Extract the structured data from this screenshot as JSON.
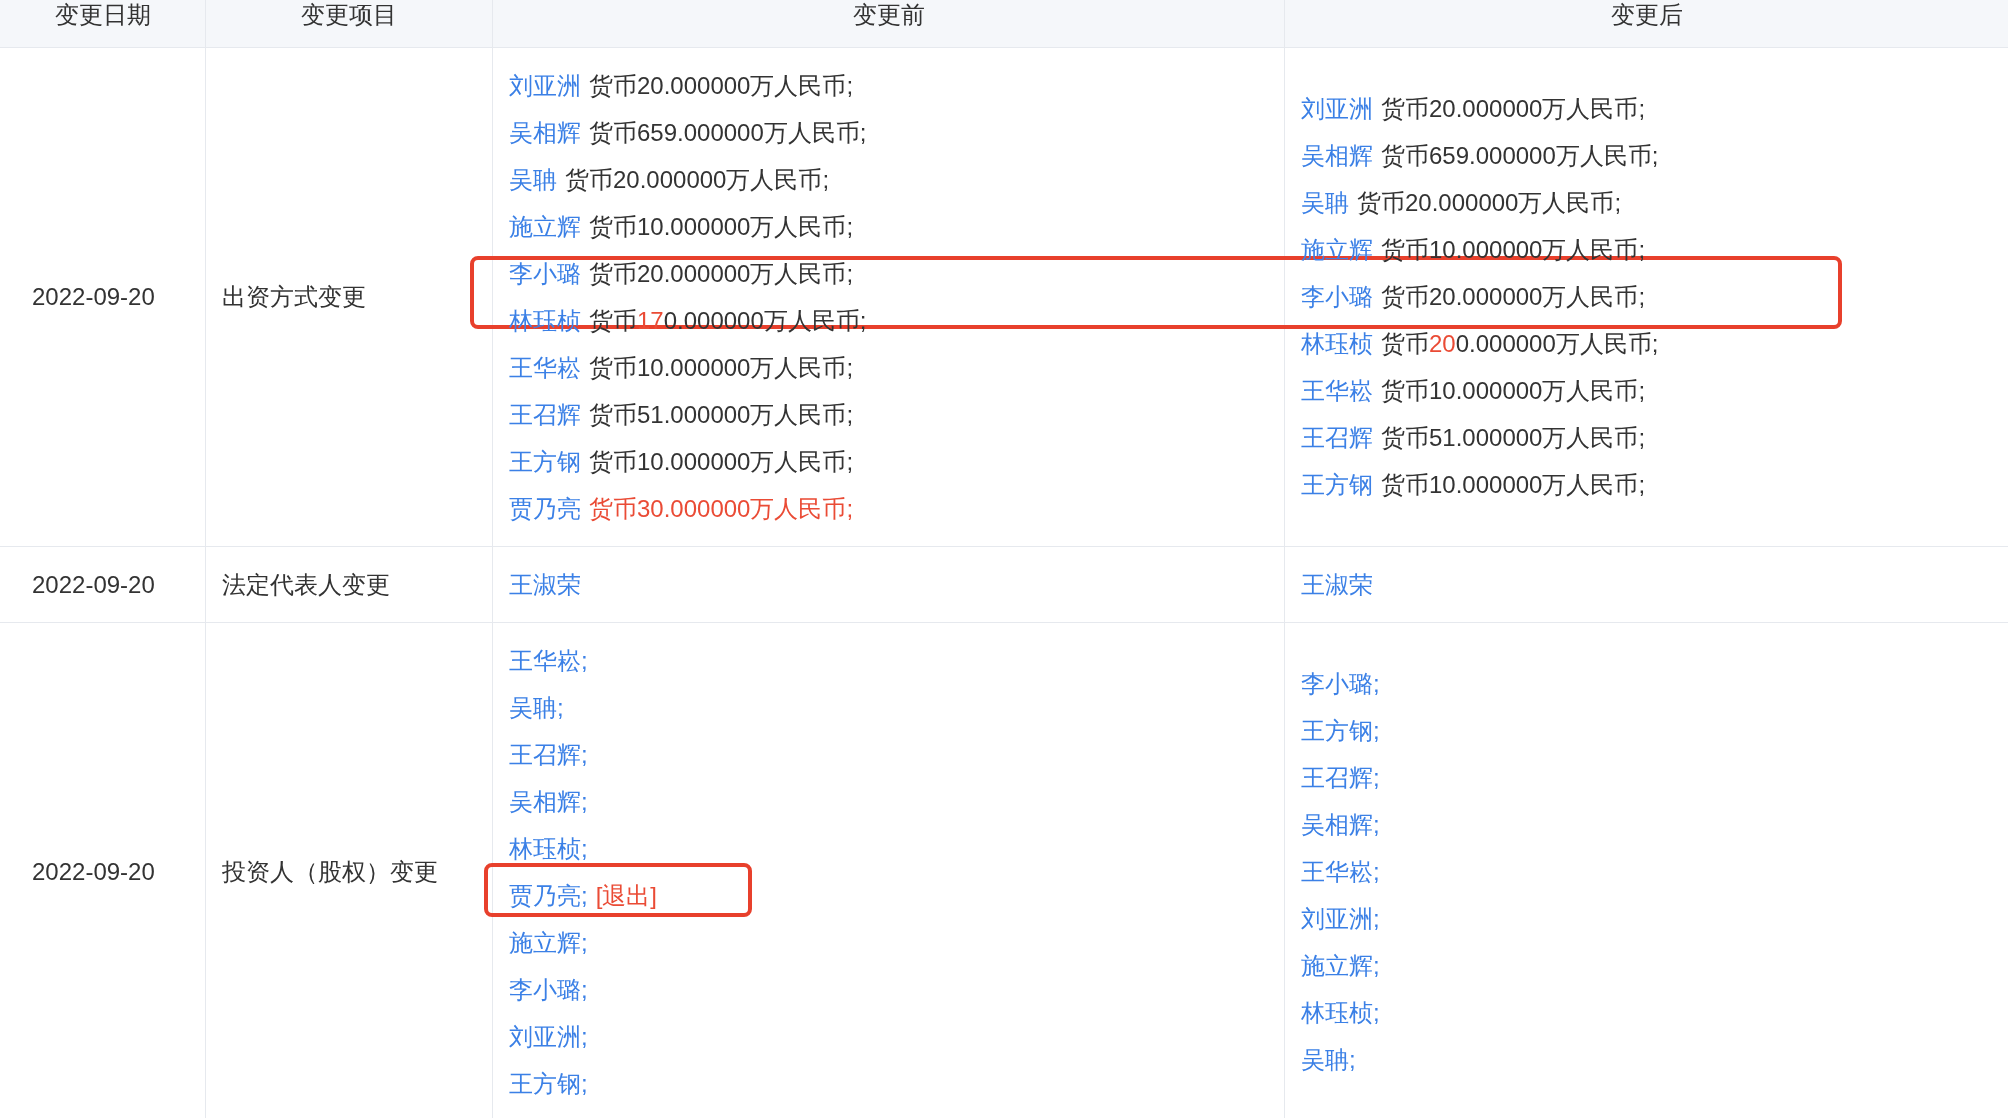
{
  "table": {
    "columns": [
      "变更日期",
      "变更项目",
      "变更前",
      "变更后"
    ],
    "rows": [
      {
        "date": "2022-09-20",
        "item": "出资方式变更",
        "before": [
          {
            "name": "刘亚洲",
            "amount": [
              {
                "text": "货币20.000000万人民币;",
                "changed": false
              }
            ]
          },
          {
            "name": "吴相辉",
            "amount": [
              {
                "text": "货币659.000000万人民币;",
                "changed": false
              }
            ]
          },
          {
            "name": "吴聃",
            "amount": [
              {
                "text": "货币20.000000万人民币;",
                "changed": false
              }
            ]
          },
          {
            "name": "施立辉",
            "amount": [
              {
                "text": "货币10.000000万人民币;",
                "changed": false
              }
            ]
          },
          {
            "name": "李小璐",
            "amount": [
              {
                "text": "货币20.000000万人民币;",
                "changed": false
              }
            ],
            "boxed": true,
            "box_spans_columns": true
          },
          {
            "name": "林珏桢",
            "amount": [
              {
                "text": "货币",
                "changed": false
              },
              {
                "text": "17",
                "changed": true
              },
              {
                "text": "0.000000万人民币;",
                "changed": false
              }
            ]
          },
          {
            "name": "王华崧",
            "amount": [
              {
                "text": "货币10.000000万人民币;",
                "changed": false
              }
            ]
          },
          {
            "name": "王召辉",
            "amount": [
              {
                "text": "货币51.000000万人民币;",
                "changed": false
              }
            ]
          },
          {
            "name": "王方钢",
            "amount": [
              {
                "text": "货币10.000000万人民币;",
                "changed": false
              }
            ]
          },
          {
            "name": "贾乃亮",
            "amount": [
              {
                "text": "货币30.000000万人民币;",
                "changed": true
              }
            ]
          }
        ],
        "after": [
          {
            "name": "刘亚洲",
            "amount": [
              {
                "text": "货币20.000000万人民币;",
                "changed": false
              }
            ]
          },
          {
            "name": "吴相辉",
            "amount": [
              {
                "text": "货币659.000000万人民币;",
                "changed": false
              }
            ]
          },
          {
            "name": "吴聃",
            "amount": [
              {
                "text": "货币20.000000万人民币;",
                "changed": false
              }
            ]
          },
          {
            "name": "施立辉",
            "amount": [
              {
                "text": "货币10.000000万人民币;",
                "changed": false
              }
            ]
          },
          {
            "name": "李小璐",
            "amount": [
              {
                "text": "货币20.000000万人民币;",
                "changed": false
              }
            ]
          },
          {
            "name": "林珏桢",
            "amount": [
              {
                "text": "货币",
                "changed": false
              },
              {
                "text": "20",
                "changed": true
              },
              {
                "text": "0.000000万人民币;",
                "changed": false
              }
            ]
          },
          {
            "name": "王华崧",
            "amount": [
              {
                "text": "货币10.000000万人民币;",
                "changed": false
              }
            ]
          },
          {
            "name": "王召辉",
            "amount": [
              {
                "text": "货币51.000000万人民币;",
                "changed": false
              }
            ]
          },
          {
            "name": "王方钢",
            "amount": [
              {
                "text": "货币10.000000万人民币;",
                "changed": false
              }
            ]
          }
        ]
      },
      {
        "date": "2022-09-20",
        "item": "法定代表人变更",
        "before": [
          {
            "name": "王淑荣"
          }
        ],
        "after": [
          {
            "name": "王淑荣"
          }
        ]
      },
      {
        "date": "2022-09-20",
        "item": "投资人（股权）变更",
        "before": [
          {
            "name": "王华崧;"
          },
          {
            "name": "吴聃;"
          },
          {
            "name": "王召辉;"
          },
          {
            "name": "吴相辉;"
          },
          {
            "name": "林珏桢;"
          },
          {
            "name": "贾乃亮;",
            "tag": "[退出]",
            "boxed": true,
            "box_spans_columns": false
          },
          {
            "name": "施立辉;"
          },
          {
            "name": "李小璐;"
          },
          {
            "name": "刘亚洲;"
          },
          {
            "name": "王方钢;"
          }
        ],
        "after": [
          {
            "name": "李小璐;"
          },
          {
            "name": "王方钢;"
          },
          {
            "name": "王召辉;"
          },
          {
            "name": "吴相辉;"
          },
          {
            "name": "王华崧;"
          },
          {
            "name": "刘亚洲;"
          },
          {
            "name": "施立辉;"
          },
          {
            "name": "林珏桢;"
          },
          {
            "name": "吴聃;"
          }
        ]
      }
    ]
  }
}
